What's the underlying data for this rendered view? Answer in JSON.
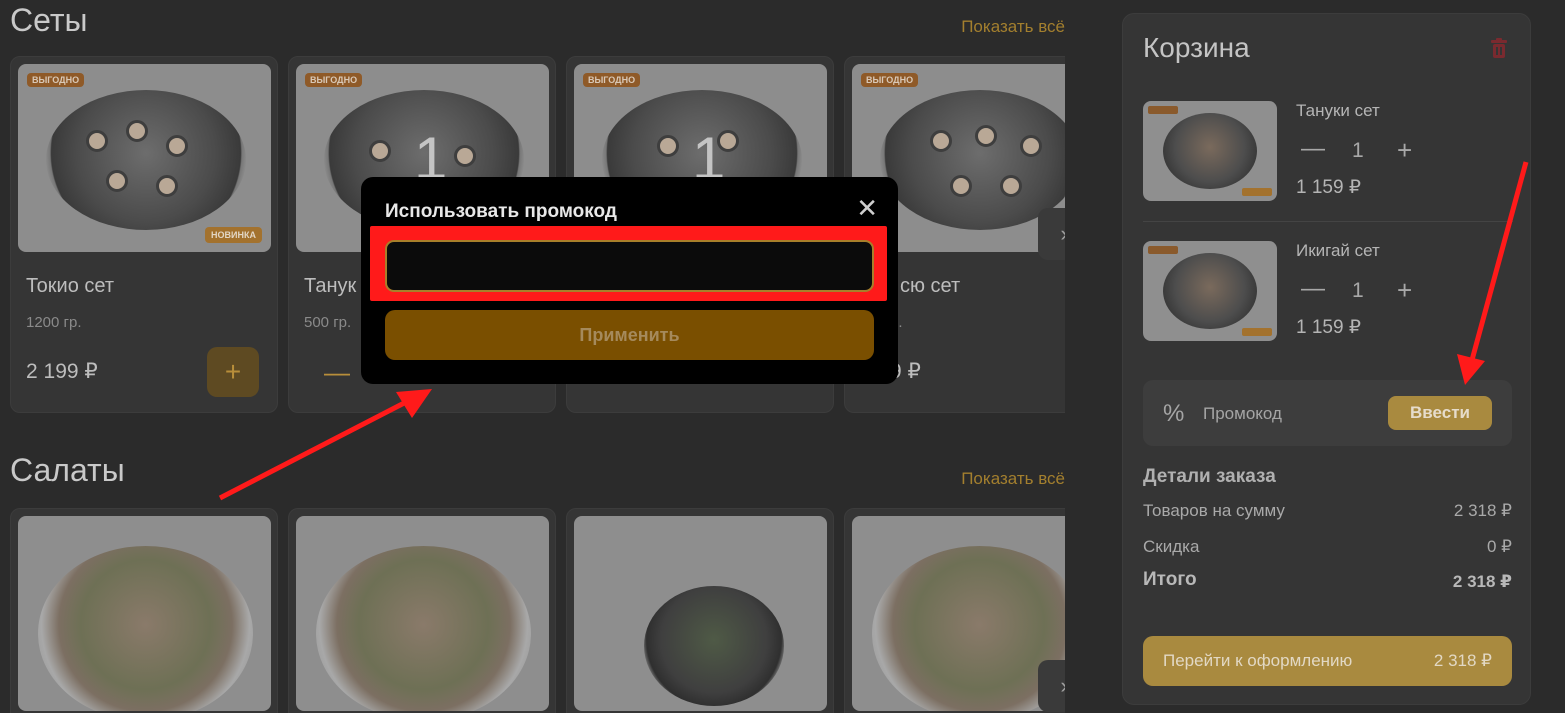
{
  "sections": {
    "sets": {
      "title": "Сеты",
      "show_all": "Показать всё",
      "cards": [
        {
          "name": "Токио сет",
          "weight": "1200 гр.",
          "price": "2 199 ₽",
          "badge_top": "ВЫГОДНО",
          "badge_bottom": "НОВИНКА"
        },
        {
          "name": "Танук",
          "weight": "500 гр.",
          "price": "",
          "badge_top": "ВЫГОДНО",
          "qty": "1"
        },
        {
          "name": "",
          "weight": "",
          "price": "",
          "badge_top": "ВЫГОДНО",
          "qty": "1"
        },
        {
          "name": "сю сет",
          "weight": "р.",
          "price": "9 ₽",
          "badge_top": "ВЫГОДНО"
        }
      ]
    },
    "salads": {
      "title": "Салаты",
      "show_all": "Показать всё"
    }
  },
  "cart": {
    "title": "Корзина",
    "items": [
      {
        "name": "Тануки сет",
        "qty": "1",
        "price": "1 159 ₽"
      },
      {
        "name": "Икигай сет",
        "qty": "1",
        "price": "1 159 ₽"
      }
    ],
    "promo": {
      "label": "Промокод",
      "button": "Ввести"
    },
    "details": {
      "title": "Детали заказа",
      "rows": [
        {
          "label": "Товаров на сумму",
          "value": "2 318 ₽"
        },
        {
          "label": "Скидка",
          "value": "0 ₽"
        }
      ],
      "total": {
        "label": "Итого",
        "value": "2 318 ₽"
      }
    },
    "checkout": {
      "label": "Перейти к оформлению",
      "sum": "2 318 ₽"
    }
  },
  "modal": {
    "title": "Использовать промокод",
    "input_value": "",
    "apply_label": "Применить"
  },
  "controls": {
    "plus": "+",
    "minus": "—",
    "close": "✕",
    "next": "›"
  },
  "colors": {
    "accent": "#a98a3f",
    "highlight": "#ff1a1a",
    "modal_bg": "#000000"
  }
}
